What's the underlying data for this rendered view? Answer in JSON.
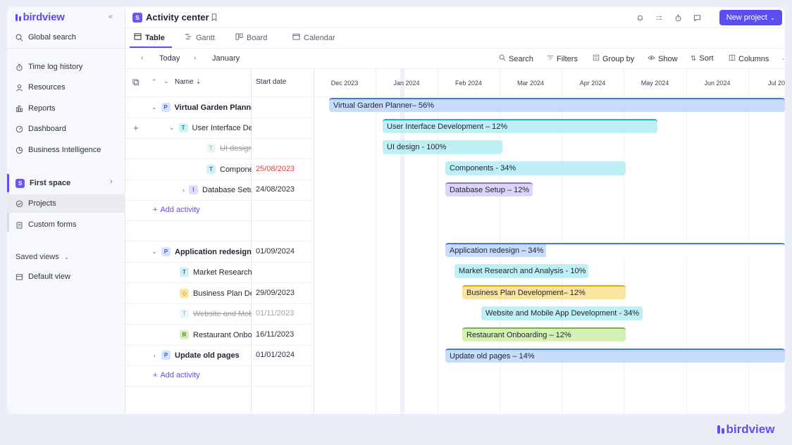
{
  "brand": {
    "name": "birdview",
    "accent": "#5b4ef0"
  },
  "sidebar": {
    "global_search": "Global search",
    "items": [
      {
        "label": "Time log history",
        "icon": "stopwatch-icon"
      },
      {
        "label": "Resources",
        "icon": "person-icon"
      },
      {
        "label": "Reports",
        "icon": "reports-icon"
      },
      {
        "label": "Dashboard",
        "icon": "gauge-icon"
      },
      {
        "label": "Business Intelligence",
        "icon": "pie-chart-icon"
      }
    ],
    "space": {
      "badge": "S",
      "label": "First space"
    },
    "space_items": [
      {
        "label": "Projects",
        "icon": "projects-icon"
      },
      {
        "label": "Custom forms",
        "icon": "clipboard-icon"
      }
    ],
    "saved_views": "Saved views",
    "default_view": "Default view"
  },
  "header": {
    "badge": "S",
    "title": "Activity center",
    "new_project": "New project"
  },
  "tabs": [
    "Table",
    "Gantt",
    "Board",
    "Calendar"
  ],
  "toolbar": {
    "today": "Today",
    "month": "January",
    "actions": [
      "Search",
      "Filters",
      "Group by",
      "Show",
      "Sort",
      "Columns"
    ]
  },
  "table": {
    "col_name": "Name",
    "col_start": "Start date",
    "add_activity": "Add activity",
    "rows": [
      {
        "type": "P",
        "name": "Virtual Garden Planner",
        "date": ""
      },
      {
        "type": "T",
        "name": "User Interface Development",
        "date": ""
      },
      {
        "type": "T",
        "name": "UI design",
        "date": ""
      },
      {
        "type": "T",
        "name": "Components",
        "date": "25/08/2023"
      },
      {
        "type": "I",
        "name": "Database Setup",
        "date": "24/08/2023"
      },
      {
        "type": "P",
        "name": "Application redesign",
        "date": "01/09/2024"
      },
      {
        "type": "T",
        "name": "Market Research and Analysis",
        "date": ""
      },
      {
        "type": "D",
        "name": "Business Plan Development",
        "date": "29/09/2023"
      },
      {
        "type": "T",
        "name": "Website and Mobile App Development",
        "date": "01/11/2023"
      },
      {
        "type": "R",
        "name": "Restaurant Onboarding",
        "date": "16/11/2023"
      },
      {
        "type": "P",
        "name": "Update old pages",
        "date": "01/01/2024"
      }
    ]
  },
  "gantt": {
    "months": [
      "Dec 2023",
      "Jan 2024",
      "Feb 2024",
      "Mar 2024",
      "Apr 2024",
      "May 2024",
      "Jun 2024",
      "Jul 20"
    ],
    "bars": [
      "Virtual Garden Planner– 56%",
      "User Interface Development – 12%",
      "UI design - 100%",
      "Components - 34%",
      "Database Setup – 12%",
      "Application redesign – 34%",
      "Market Research and Analysis - 10%",
      "Business Plan Development– 12%",
      "Website and Mobile App Development - 34%",
      "Restaurant Onboarding – 12%",
      "Update old pages – 14%"
    ]
  }
}
